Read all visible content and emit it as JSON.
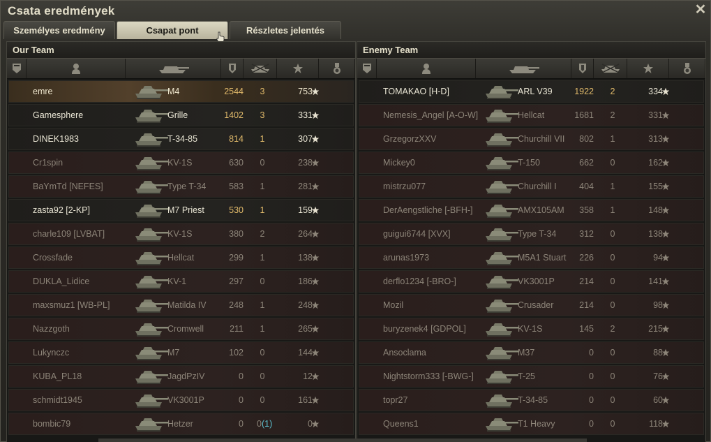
{
  "window": {
    "title": "Csata eredmények",
    "close_icon": "close-icon"
  },
  "tabs": [
    {
      "label": "Személyes eredmény",
      "active": false
    },
    {
      "label": "Csapat pont",
      "active": true
    },
    {
      "label": "Részletes jelentés",
      "active": false
    }
  ],
  "headers": {
    "squad_icon": "badge-icon",
    "player_icon": "person-icon",
    "tank_icon": "tank-icon",
    "damage_icon": "shield-icon",
    "kills_icon": "destroyed-tank-icon",
    "xp_icon": "star-icon",
    "medal_icon": "medal-icon"
  },
  "colors": {
    "damage": "#e0b96a",
    "alive_text": "#e9e5d4",
    "dead_text": "#8c8478",
    "self_highlight": "#52402b",
    "extra_kill": "#5cc0d0"
  },
  "our_team": {
    "title": "Our Team",
    "players": [
      {
        "name": "emre",
        "tank": "M4",
        "damage": "2544",
        "kills": "3",
        "kills_extra": "",
        "xp": "753",
        "state": "self"
      },
      {
        "name": "Gamesphere",
        "tank": "Grille",
        "damage": "1402",
        "kills": "3",
        "kills_extra": "",
        "xp": "331",
        "state": "alive"
      },
      {
        "name": "DINEK1983",
        "tank": "T-34-85",
        "damage": "814",
        "kills": "1",
        "kills_extra": "",
        "xp": "307",
        "state": "alive"
      },
      {
        "name": "Cr1spin",
        "tank": "KV-1S",
        "damage": "630",
        "kills": "0",
        "kills_extra": "",
        "xp": "238",
        "state": "dead"
      },
      {
        "name": "BaYmTd [NEFES]",
        "tank": "Type T-34",
        "damage": "583",
        "kills": "1",
        "kills_extra": "",
        "xp": "281",
        "state": "dead"
      },
      {
        "name": "zasta92 [2-KP]",
        "tank": "M7 Priest",
        "damage": "530",
        "kills": "1",
        "kills_extra": "",
        "xp": "159",
        "state": "alive"
      },
      {
        "name": "charle109 [LVBAT]",
        "tank": "KV-1S",
        "damage": "380",
        "kills": "2",
        "kills_extra": "",
        "xp": "264",
        "state": "dead"
      },
      {
        "name": "Crossfade",
        "tank": "Hellcat",
        "damage": "299",
        "kills": "1",
        "kills_extra": "",
        "xp": "138",
        "state": "dead"
      },
      {
        "name": "DUKLA_Lidice",
        "tank": "KV-1",
        "damage": "297",
        "kills": "0",
        "kills_extra": "",
        "xp": "186",
        "state": "dead"
      },
      {
        "name": "maxsmuz1 [WB-PL]",
        "tank": "Matilda IV",
        "damage": "248",
        "kills": "1",
        "kills_extra": "",
        "xp": "248",
        "state": "dead"
      },
      {
        "name": "Nazzgoth",
        "tank": "Cromwell",
        "damage": "211",
        "kills": "1",
        "kills_extra": "",
        "xp": "265",
        "state": "dead"
      },
      {
        "name": "Lukynczc",
        "tank": "M7",
        "damage": "102",
        "kills": "0",
        "kills_extra": "",
        "xp": "144",
        "state": "dead"
      },
      {
        "name": "KUBA_PL18",
        "tank": "JagdPzIV",
        "damage": "0",
        "kills": "0",
        "kills_extra": "",
        "xp": "12",
        "state": "dead"
      },
      {
        "name": "schmidt1945",
        "tank": "VK3001P",
        "damage": "0",
        "kills": "0",
        "kills_extra": "",
        "xp": "161",
        "state": "dead"
      },
      {
        "name": "bombic79",
        "tank": "Hetzer",
        "damage": "0",
        "kills": "0",
        "kills_extra": "(1)",
        "xp": "0",
        "state": "dead"
      }
    ]
  },
  "enemy_team": {
    "title": "Enemy Team",
    "players": [
      {
        "name": "TOMAKAO [H-D]",
        "tank": "ARL V39",
        "damage": "1922",
        "kills": "2",
        "kills_extra": "",
        "xp": "334",
        "state": "alive"
      },
      {
        "name": "Nemesis_Angel [A-O-W]",
        "tank": "Hellcat",
        "damage": "1681",
        "kills": "2",
        "kills_extra": "",
        "xp": "331",
        "state": "dead"
      },
      {
        "name": "GrzegorzXXV",
        "tank": "Churchill VII",
        "damage": "802",
        "kills": "1",
        "kills_extra": "",
        "xp": "313",
        "state": "dead"
      },
      {
        "name": "Mickey0",
        "tank": "T-150",
        "damage": "662",
        "kills": "0",
        "kills_extra": "",
        "xp": "162",
        "state": "dead"
      },
      {
        "name": "mistrzu077",
        "tank": "Churchill I",
        "damage": "404",
        "kills": "1",
        "kills_extra": "",
        "xp": "155",
        "state": "dead"
      },
      {
        "name": "DerAengstliche [-BFH-]",
        "tank": "AMX105AM",
        "damage": "358",
        "kills": "1",
        "kills_extra": "",
        "xp": "148",
        "state": "dead"
      },
      {
        "name": "guigui6744 [XVX]",
        "tank": "Type T-34",
        "damage": "312",
        "kills": "0",
        "kills_extra": "",
        "xp": "138",
        "state": "dead"
      },
      {
        "name": "arunas1973",
        "tank": "M5A1 Stuart",
        "damage": "226",
        "kills": "0",
        "kills_extra": "",
        "xp": "94",
        "state": "dead"
      },
      {
        "name": "derflo1234 [-BRO-]",
        "tank": "VK3001P",
        "damage": "214",
        "kills": "0",
        "kills_extra": "",
        "xp": "141",
        "state": "dead"
      },
      {
        "name": "Mozil",
        "tank": "Crusader",
        "damage": "214",
        "kills": "0",
        "kills_extra": "",
        "xp": "98",
        "state": "dead"
      },
      {
        "name": "buryzenek4 [GDPOL]",
        "tank": "KV-1S",
        "damage": "145",
        "kills": "2",
        "kills_extra": "",
        "xp": "215",
        "state": "dead"
      },
      {
        "name": "Ansoclama",
        "tank": "M37",
        "damage": "0",
        "kills": "0",
        "kills_extra": "",
        "xp": "88",
        "state": "dead"
      },
      {
        "name": "Nightstorm333 [-BWG-]",
        "tank": "T-25",
        "damage": "0",
        "kills": "0",
        "kills_extra": "",
        "xp": "76",
        "state": "dead"
      },
      {
        "name": "topr27",
        "tank": "T-34-85",
        "damage": "0",
        "kills": "0",
        "kills_extra": "",
        "xp": "60",
        "state": "dead"
      },
      {
        "name": "Queens1",
        "tank": "T1 Heavy",
        "damage": "0",
        "kills": "0",
        "kills_extra": "",
        "xp": "118",
        "state": "dead"
      }
    ]
  }
}
